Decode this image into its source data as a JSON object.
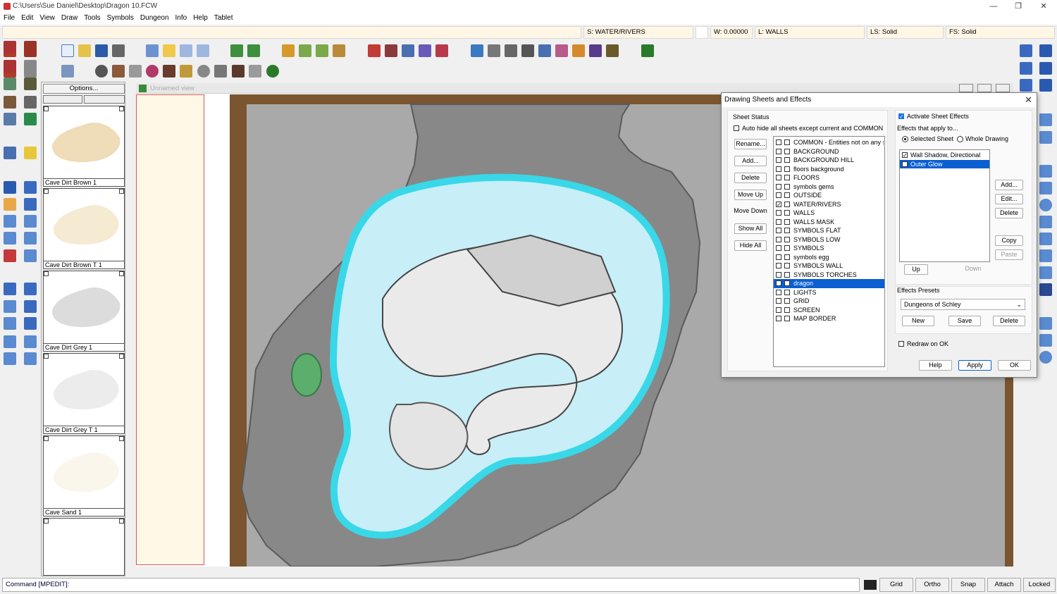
{
  "window": {
    "title": "C:\\Users\\Sue Daniel\\Desktop\\Dragon 10.FCW",
    "minimize": "—",
    "maximize": "❐",
    "close": "✕"
  },
  "menu": [
    "File",
    "Edit",
    "View",
    "Draw",
    "Tools",
    "Symbols",
    "Dungeon",
    "Info",
    "Help",
    "Tablet"
  ],
  "status": {
    "sheet": "S: WATER/RIVERS",
    "width": "W: 0.00000",
    "layer": "L: WALLS",
    "line_style": "LS: Solid",
    "fill_style": "FS: Solid"
  },
  "palette": {
    "options_label": "Options...",
    "tiles": [
      "Cave Dirt Brown 1",
      "Cave Dirt Brown T 1",
      "Cave Dirt Grey 1",
      "Cave Dirt Grey T 1",
      "Cave Sand 1",
      ""
    ]
  },
  "view": {
    "title": "Unnamed view"
  },
  "dialog": {
    "title": "Drawing Sheets and Effects",
    "close": "✕",
    "sheet_status_label": "Sheet Status",
    "auto_hide_label": "Auto hide all sheets except current and COMMON",
    "buttons_left": [
      "Rename...",
      "Add...",
      "Delete",
      "Move Up",
      "Move Down",
      "Show All",
      "Hide All"
    ],
    "sheets": [
      {
        "name": "COMMON - Entities not on any sheet",
        "checked": false
      },
      {
        "name": "BACKGROUND",
        "checked": false
      },
      {
        "name": "BACKGROUND HILL",
        "checked": false
      },
      {
        "name": "floors background",
        "checked": false
      },
      {
        "name": "FLOORS",
        "checked": false
      },
      {
        "name": "symbols gems",
        "checked": false
      },
      {
        "name": "OUTSIDE",
        "checked": false
      },
      {
        "name": "WATER/RIVERS",
        "checked": true
      },
      {
        "name": "WALLS",
        "checked": false
      },
      {
        "name": "WALLS MASK",
        "checked": false
      },
      {
        "name": "SYMBOLS FLAT",
        "checked": false
      },
      {
        "name": "SYMBOLS LOW",
        "checked": false
      },
      {
        "name": "SYMBOLS",
        "checked": false
      },
      {
        "name": "symbols egg",
        "checked": false
      },
      {
        "name": "SYMBOLS WALL",
        "checked": false
      },
      {
        "name": "SYMBOLS TORCHES",
        "checked": false
      },
      {
        "name": "dragon",
        "checked": false,
        "selected": true
      },
      {
        "name": "LIGHTS",
        "checked": false
      },
      {
        "name": "GRID",
        "checked": false
      },
      {
        "name": "SCREEN",
        "checked": false
      },
      {
        "name": "MAP BORDER",
        "checked": false
      }
    ],
    "activate_effects_label": "Activate Sheet Effects",
    "effects_apply_label": "Effects that apply to...",
    "selected_sheet_label": "Selected Sheet",
    "whole_drawing_label": "Whole Drawing",
    "effects": [
      {
        "name": "Wall Shadow, Directional",
        "checked": true
      },
      {
        "name": "Outer Glow",
        "checked": false,
        "selected": true
      }
    ],
    "effect_buttons": [
      "Add...",
      "Edit...",
      "Delete",
      "Copy",
      "Paste"
    ],
    "up_label": "Up",
    "down_label": "Down",
    "presets_label": "Effects Presets",
    "preset_value": "Dungeons of Schley",
    "preset_buttons": [
      "New",
      "Save",
      "Delete"
    ],
    "redraw_label": "Redraw on OK",
    "bottom_buttons": [
      "Help",
      "Apply",
      "OK"
    ]
  },
  "command": {
    "text": "Command [MPEDIT]:"
  },
  "modes": [
    "Grid",
    "Ortho",
    "Snap",
    "Attach",
    "Locked"
  ],
  "colors": {
    "water": "#c8eef7",
    "glow": "#38d8e8",
    "cave_floor": "#888888",
    "rock": "#a9a9a9",
    "selection": "#0a5fd1"
  }
}
